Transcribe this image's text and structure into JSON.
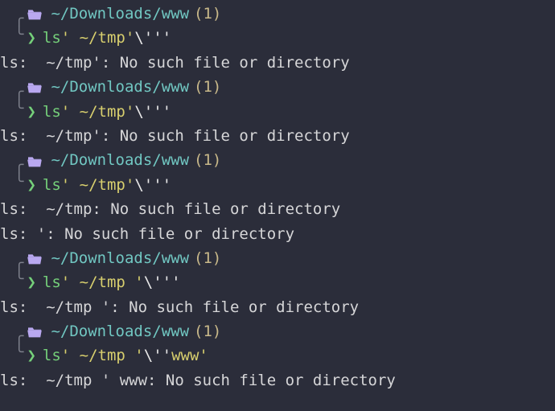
{
  "prompt_path": "~/Downloads/www",
  "prompt_count": "(1)",
  "blocks": [
    {
      "cmd_name": "ls",
      "arg_yellow": " ' ~/tmp'",
      "arg_plain": "\\'''",
      "outputs": [
        "ls:  ~/tmp': No such file or directory"
      ]
    },
    {
      "cmd_name": "ls",
      "arg_yellow": " ' ~/tmp'",
      "arg_plain": "\\'''",
      "outputs": [
        "ls:  ~/tmp': No such file or directory"
      ]
    },
    {
      "cmd_name": "ls",
      "arg_yellow": " ' ~/tmp'",
      "arg_plain": " \\'''",
      "outputs": [
        "ls:  ~/tmp: No such file or directory",
        "ls: ': No such file or directory"
      ]
    },
    {
      "cmd_name": "ls",
      "arg_yellow": " ' ~/tmp '",
      "arg_plain": "\\'''",
      "outputs": [
        "ls:  ~/tmp ': No such file or directory"
      ]
    },
    {
      "cmd_name": "ls",
      "arg_yellow": " ' ~/tmp '",
      "arg_plain": "\\''",
      "arg_yellow2": " www'",
      "outputs": [
        "ls:  ~/tmp ' www: No such file or directory"
      ]
    }
  ]
}
